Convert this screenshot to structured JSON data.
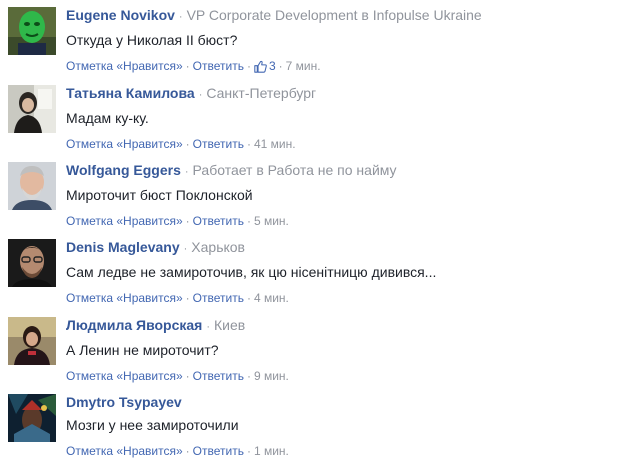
{
  "comments": [
    {
      "name": "Eugene Novikov",
      "meta": "VP Corporate Development в Infopulse Ukraine",
      "text": "Откуда у Николая II бюст?",
      "like_label": "Отметка «Нравится»",
      "reply_label": "Ответить",
      "likes": "3",
      "time": "7 мин.",
      "avatar": "avatar-green-mask"
    },
    {
      "name": "Татьяна Камилова",
      "meta": "Санкт-Петербург",
      "text": "Мадам ку-ку.",
      "like_label": "Отметка «Нравится»",
      "reply_label": "Ответить",
      "time": "41 мин.",
      "avatar": "avatar-woman-window"
    },
    {
      "name": "Wolfgang Eggers",
      "meta": "Работает в Работа не по найму",
      "text": "Мироточит бюст Поклонской",
      "like_label": "Отметка «Нравится»",
      "reply_label": "Ответить",
      "time": "5 мин.",
      "avatar": "avatar-man-beard"
    },
    {
      "name": "Denis Maglevany",
      "meta": "Харьков",
      "text": "Сам ледве не замироточив, як цю нісенітницю дивився...",
      "like_label": "Отметка «Нравится»",
      "reply_label": "Ответить",
      "time": "4 мин.",
      "avatar": "avatar-man-glasses"
    },
    {
      "name": "Людмила Яворская",
      "meta": "Киев",
      "text": "А Ленин не мироточит?",
      "like_label": "Отметка «Нравится»",
      "reply_label": "Ответить",
      "time": "9 мин.",
      "avatar": "avatar-woman-dark"
    },
    {
      "name": "Dmytro Tsypayev",
      "meta": "",
      "text": "Мозги у нее замироточили",
      "like_label": "Отметка «Нравится»",
      "reply_label": "Ответить",
      "time": "1 мин.",
      "avatar": "avatar-game-art"
    }
  ],
  "colors": {
    "name": "#365899",
    "link": "#4267b2",
    "meta": "#90949c",
    "text": "#1d2129",
    "like_icon": "#4267b2"
  }
}
